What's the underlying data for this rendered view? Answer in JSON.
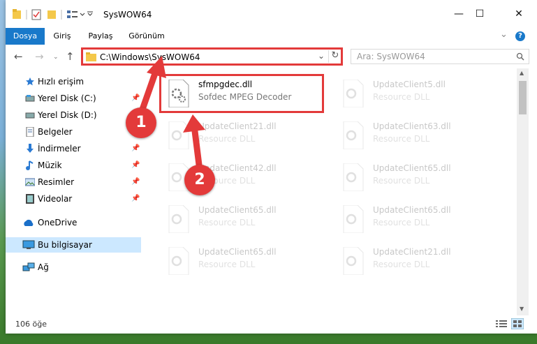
{
  "window": {
    "title": "SysWOW64",
    "minimize_glyph": "—",
    "maximize_glyph": "☐",
    "close_glyph": "✕"
  },
  "ribbon": {
    "tabs": [
      {
        "label": "Dosya",
        "active": true
      },
      {
        "label": "Giriş"
      },
      {
        "label": "Paylaş"
      },
      {
        "label": "Görünüm"
      }
    ],
    "expand_glyph": "⌄",
    "help_glyph": "?"
  },
  "address_bar": {
    "path": "C:\\Windows\\SysWOW64",
    "search_placeholder": "Ara: SysWOW64"
  },
  "nav_pane": {
    "items": [
      {
        "label": "Hızlı erişim",
        "icon": "star-icon"
      },
      {
        "label": "Yerel Disk (C:)",
        "icon": "drive-icon",
        "pinned": true
      },
      {
        "label": "Yerel Disk (D:)",
        "icon": "drive-icon",
        "pinned": true
      },
      {
        "label": "Belgeler",
        "icon": "document-icon",
        "pinned": true
      },
      {
        "label": "İndirmeler",
        "icon": "download-icon",
        "pinned": true
      },
      {
        "label": "Müzik",
        "icon": "music-icon",
        "pinned": true
      },
      {
        "label": "Resimler",
        "icon": "pictures-icon",
        "pinned": true
      },
      {
        "label": "Videolar",
        "icon": "video-icon",
        "pinned": true
      },
      {
        "label": "OneDrive",
        "icon": "cloud-icon"
      },
      {
        "label": "Bu bilgisayar",
        "icon": "computer-icon",
        "selected": true
      },
      {
        "label": "Ağ",
        "icon": "network-icon"
      }
    ]
  },
  "files": [
    {
      "name": "sfmpgdec.dll",
      "desc": "Sofdec MPEG Decoder",
      "highlighted": true
    },
    {
      "name": "UpdateClient5.dll",
      "desc": "Resource DLL"
    },
    {
      "name": "UpdateClient21.dll",
      "desc": "Resource DLL"
    },
    {
      "name": "UpdateClient63.dll",
      "desc": "Resource DLL"
    },
    {
      "name": "UpdateClient42.dll",
      "desc": "Resource DLL"
    },
    {
      "name": "UpdateClient65.dll",
      "desc": "Resource DLL"
    },
    {
      "name": "UpdateClient65.dll",
      "desc": "Resource DLL"
    },
    {
      "name": "UpdateClient65.dll",
      "desc": "Resource DLL"
    },
    {
      "name": "UpdateClient65.dll",
      "desc": "Resource DLL"
    },
    {
      "name": "UpdateClient21.dll",
      "desc": "Resource DLL"
    }
  ],
  "status_bar": {
    "count": "106 öğe"
  },
  "annotations": {
    "step1": "1",
    "step2": "2",
    "color": "#e33a3a"
  }
}
